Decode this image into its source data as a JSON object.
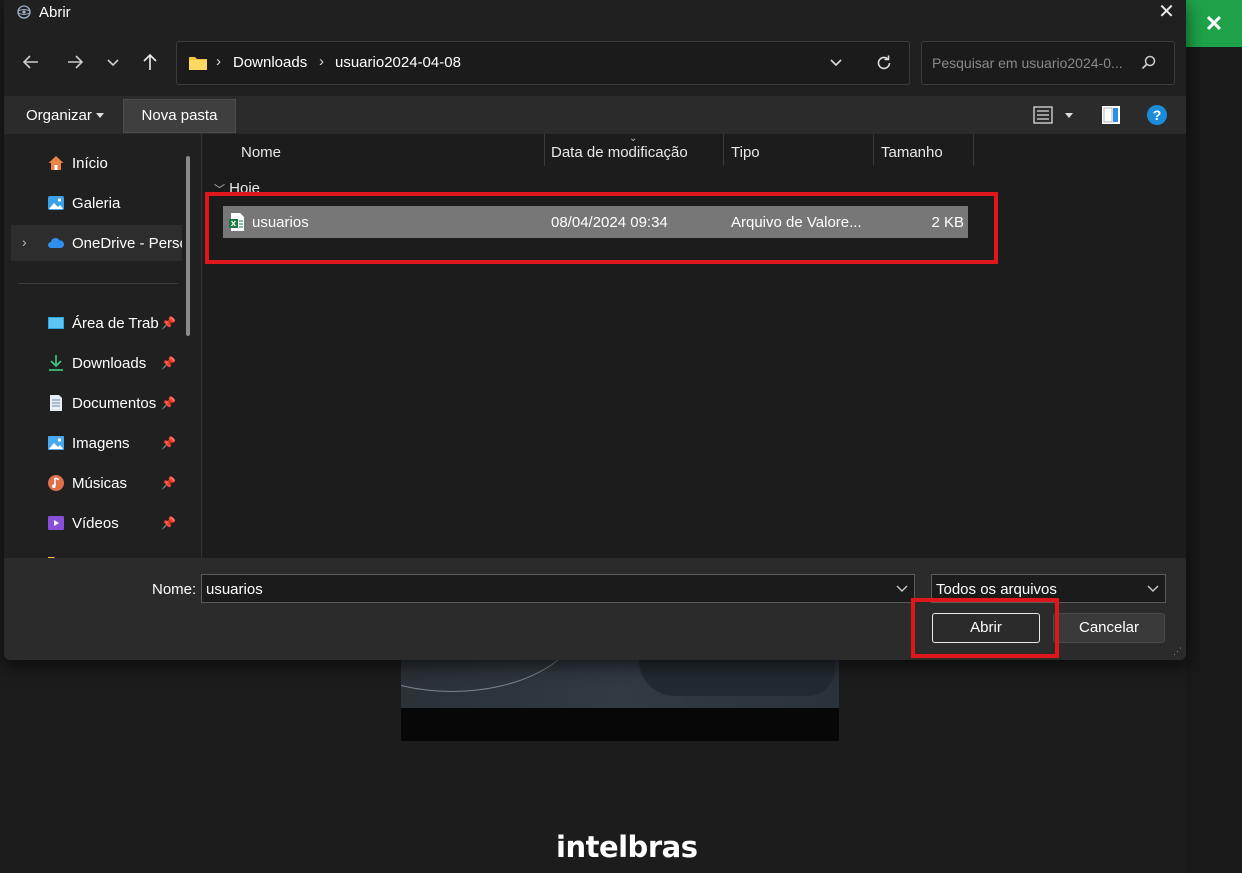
{
  "background": {
    "logo_text": "intelbras",
    "close_glyph": "✕",
    "accent_color": "#1ea34a"
  },
  "dialog": {
    "title": "Abrir",
    "close_glyph": "✕",
    "nav": {
      "back_icon": "arrow-left-icon",
      "forward_icon": "arrow-right-icon",
      "recent_icon": "chevron-down-icon",
      "up_icon": "arrow-up-icon"
    },
    "address": {
      "crumbs": [
        "Downloads",
        "usuario2024-04-08"
      ],
      "separator": "›"
    },
    "search": {
      "placeholder": "Pesquisar em usuario2024-0..."
    },
    "toolbar": {
      "organizar_label": "Organizar",
      "nova_pasta_label": "Nova pasta"
    },
    "sidebar": {
      "items": [
        {
          "label": "Início",
          "icon": "home-icon",
          "pinned": false
        },
        {
          "label": "Galeria",
          "icon": "gallery-icon",
          "pinned": false
        },
        {
          "label": "OneDrive - Perso",
          "icon": "onedrive-icon",
          "pinned": false
        },
        {
          "label": "Área de Trab",
          "icon": "desktop-icon",
          "pinned": true
        },
        {
          "label": "Downloads",
          "icon": "download-icon",
          "pinned": true
        },
        {
          "label": "Documentos",
          "icon": "document-icon",
          "pinned": true
        },
        {
          "label": "Imagens",
          "icon": "image-icon",
          "pinned": true
        },
        {
          "label": "Músicas",
          "icon": "music-icon",
          "pinned": true
        },
        {
          "label": "Vídeos",
          "icon": "video-icon",
          "pinned": true
        }
      ],
      "pin_glyph": "📌"
    },
    "columns": {
      "name": "Nome",
      "date": "Data de modificação",
      "type": "Tipo",
      "size": "Tamanho"
    },
    "group_label": "Hoje",
    "files": [
      {
        "name": "usuarios",
        "date": "08/04/2024 09:34",
        "type": "Arquivo de Valore...",
        "size": "2 KB",
        "icon": "excel-csv-icon",
        "selected": true
      }
    ],
    "bottom": {
      "nome_label": "Nome:",
      "nome_value": "usuarios",
      "filter_value": "Todos os arquivos",
      "open_label": "Abrir",
      "cancel_label": "Cancelar"
    },
    "highlight_color": "#e0161d"
  }
}
